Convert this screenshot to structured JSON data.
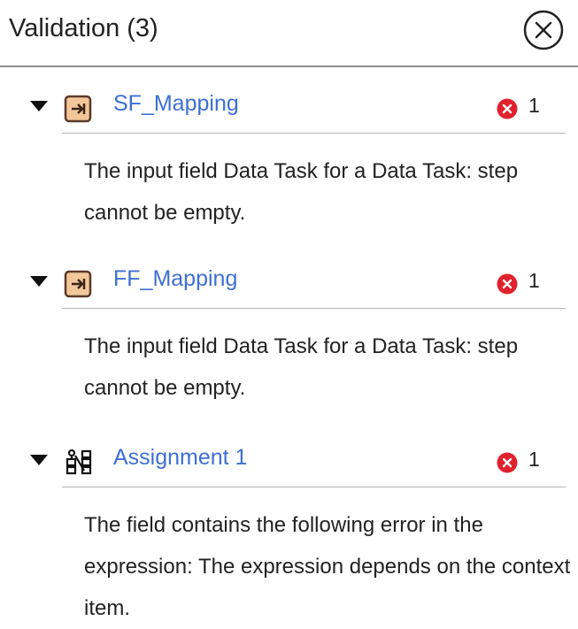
{
  "panel": {
    "title": "Validation (3)",
    "close_icon": "close-circle-icon"
  },
  "items": [
    {
      "name": "SF_Mapping",
      "type_icon": "mapping-task-icon",
      "error_icon": "error-x-icon",
      "error_count": "1",
      "message": "The input field Data Task for a Data Task: step cannot be empty."
    },
    {
      "name": "FF_Mapping",
      "type_icon": "mapping-task-icon",
      "error_icon": "error-x-icon",
      "error_count": "1",
      "message": "The input field Data Task for a Data Task: step cannot be empty."
    },
    {
      "name": "Assignment 1",
      "type_icon": "assignment-icon",
      "error_icon": "error-x-icon",
      "error_count": "1",
      "message": "The field contains the following error in the expression: The expression depends on the context item."
    }
  ],
  "colors": {
    "link": "#3d6fd3",
    "error": "#e0222e",
    "mapping_icon_fill": "#f3c79a",
    "mapping_icon_stroke": "#5b3a2a"
  }
}
